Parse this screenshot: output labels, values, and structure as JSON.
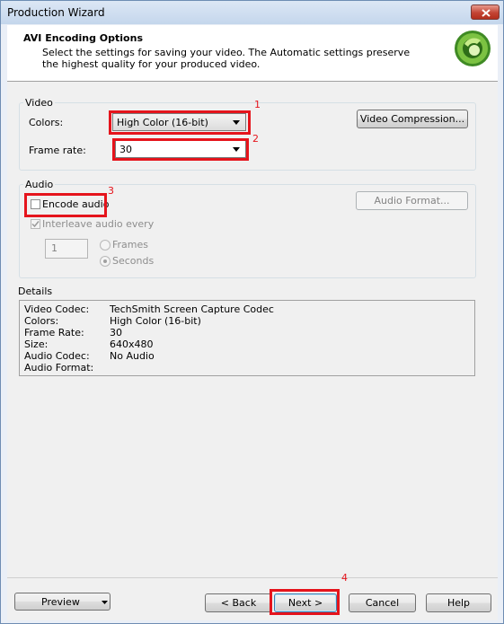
{
  "window": {
    "title": "Production Wizard"
  },
  "header": {
    "title": "AVI Encoding Options",
    "description": "Select the settings for saving your video.  The Automatic settings preserve the highest quality for your produced video."
  },
  "video": {
    "group_label": "Video",
    "colors_label": "Colors:",
    "colors_value": "High Color (16-bit)",
    "frame_rate_label": "Frame rate:",
    "frame_rate_value": "30",
    "compression_button": "Video Compression..."
  },
  "audio": {
    "group_label": "Audio",
    "encode_audio_label": "Encode audio",
    "encode_audio_checked": false,
    "audio_format_button": "Audio Format...",
    "interleave_label": "Interleave audio every",
    "interleave_checked": true,
    "interleave_value": "1",
    "frames_label": "Frames",
    "seconds_label": "Seconds",
    "selected_unit": "Seconds"
  },
  "details": {
    "label": "Details",
    "rows": [
      {
        "key": "Video Codec:",
        "value": "TechSmith Screen Capture Codec"
      },
      {
        "key": "Colors:",
        "value": "High Color (16-bit)"
      },
      {
        "key": "Frame Rate:",
        "value": "30"
      },
      {
        "key": "Size:",
        "value": "640x480"
      },
      {
        "key": "Audio Codec:",
        "value": "No Audio"
      },
      {
        "key": "Audio Format:",
        "value": ""
      }
    ]
  },
  "footer": {
    "preview": "Preview",
    "back": "< Back",
    "next": "Next >",
    "cancel": "Cancel",
    "help": "Help"
  },
  "annotations": {
    "a1": "1",
    "a2": "2",
    "a3": "3",
    "a4": "4"
  },
  "colors": {
    "annotation": "#e5141c",
    "titlebar": "#c4d6ec",
    "logo": "#5aa832"
  }
}
